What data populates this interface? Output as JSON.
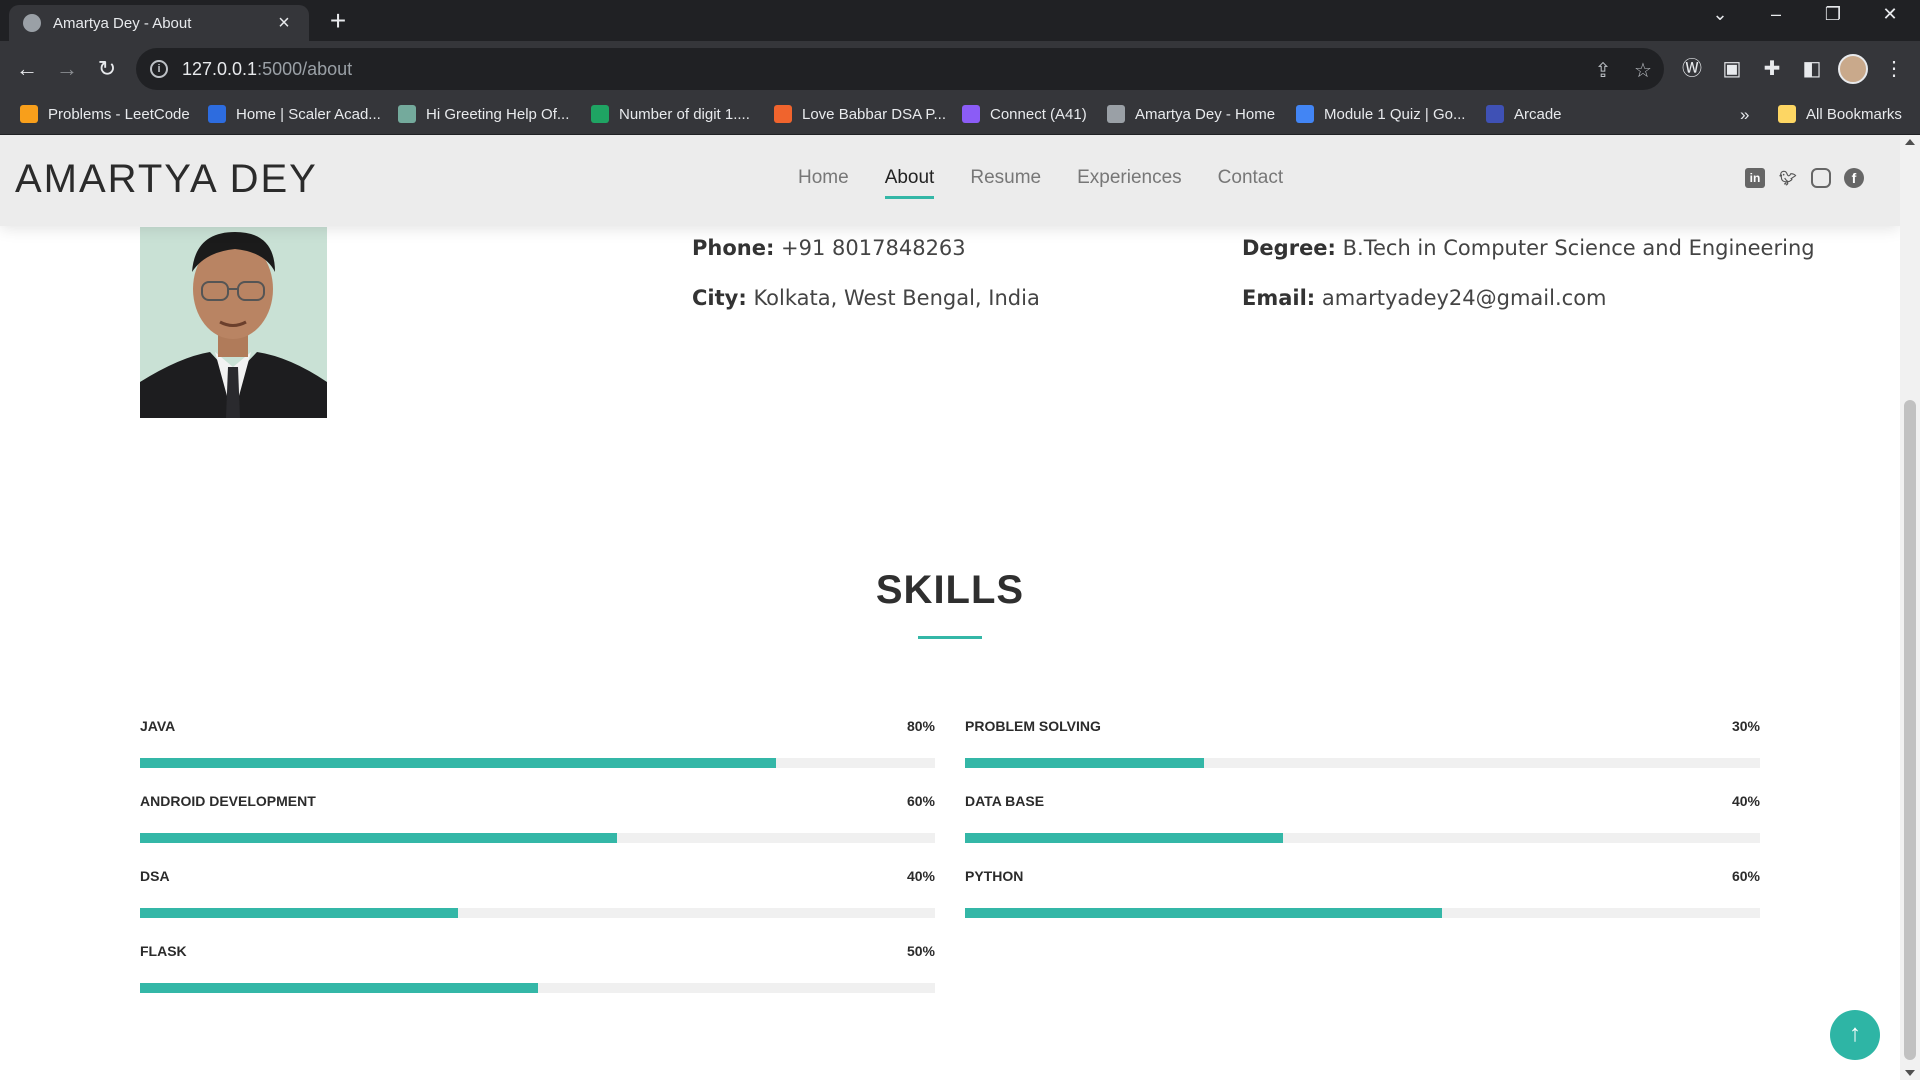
{
  "browser": {
    "tab_title": "Amartya Dey - About",
    "url_host": "127.0.0.1",
    "url_path": ":5000/about",
    "bookmarks": [
      {
        "label": "Problems - LeetCode",
        "color": "#f89f1b"
      },
      {
        "label": "Home | Scaler Acad...",
        "color": "#2d6cdf"
      },
      {
        "label": "Hi Greeting Help Of...",
        "color": "#74aa9c"
      },
      {
        "label": "Number of digit 1....",
        "color": "#1fa463"
      },
      {
        "label": "Love Babbar DSA P...",
        "color": "#f0642d"
      },
      {
        "label": "Connect (A41)",
        "color": "#8b5cf6"
      },
      {
        "label": "Amartya Dey - Home",
        "color": "#9aa0a6"
      },
      {
        "label": "Module 1 Quiz | Go...",
        "color": "#4285f4"
      },
      {
        "label": "Arcade",
        "color": "#3f51b5"
      }
    ],
    "all_bookmarks": "All Bookmarks",
    "overflow": "»"
  },
  "site": {
    "logo": "AMARTYA DEY",
    "nav": [
      "Home",
      "About",
      "Resume",
      "Experiences",
      "Contact"
    ],
    "active_nav": "About"
  },
  "about": {
    "phone_label": "Phone:",
    "phone": "+91 8017848263",
    "city_label": "City:",
    "city": "Kolkata, West Bengal, India",
    "degree_label": "Degree:",
    "degree": "B.Tech in Computer Science and Engineering",
    "email_label": "Email:",
    "email": "amartyadey24@gmail.com"
  },
  "skills": {
    "title": "SKILLS",
    "items": [
      {
        "name": "JAVA",
        "percent_label": "80%",
        "value": 80
      },
      {
        "name": "PROBLEM SOLVING",
        "percent_label": "30%",
        "value": 30
      },
      {
        "name": "ANDROID DEVELOPMENT",
        "percent_label": "60%",
        "value": 60
      },
      {
        "name": "DATA BASE",
        "percent_label": "40%",
        "value": 40
      },
      {
        "name": "DSA",
        "percent_label": "40%",
        "value": 40
      },
      {
        "name": "PYTHON",
        "percent_label": "60%",
        "value": 60
      },
      {
        "name": "FLASK",
        "percent_label": "50%",
        "value": 50
      }
    ]
  },
  "colors": {
    "accent": "#34b7a7",
    "track": "#f0f0f0"
  }
}
